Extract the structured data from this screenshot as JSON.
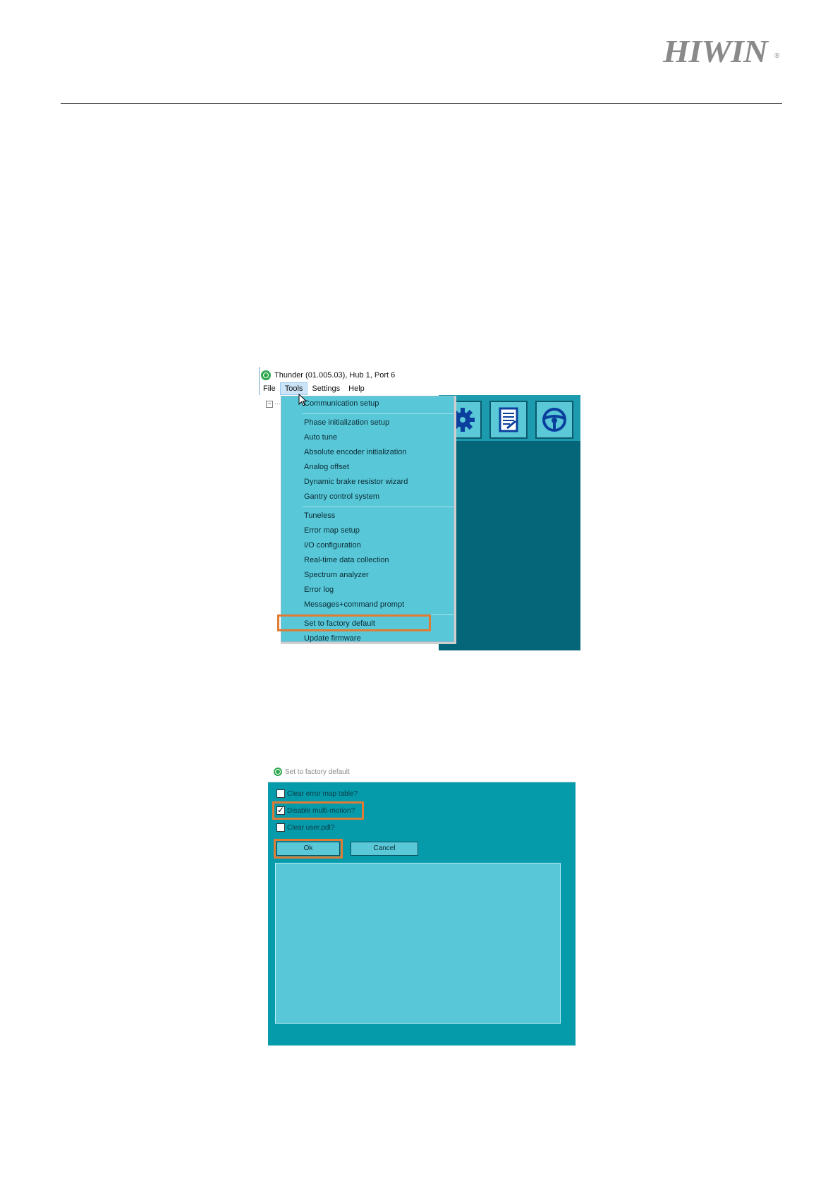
{
  "header": {
    "logo": "HIWIN",
    "logo_mark": "®"
  },
  "tools_menu_screenshot": {
    "title": "Thunder (01.005.03), Hub 1, Port 6",
    "menubar": [
      "File",
      "Tools",
      "Settings",
      "Help"
    ],
    "tree_toggle": "−",
    "tree_dots": "···",
    "active_menu": "Tools",
    "toolbar_icons": [
      "gear-icon",
      "notepad-icon",
      "steering-wheel-icon"
    ],
    "menu_items": [
      "Communication setup",
      "Phase initialization setup",
      "Auto tune",
      "Absolute encoder initialization",
      "Analog offset",
      "Dynamic brake resistor wizard",
      "Gantry control system",
      "Tuneless",
      "Error map setup",
      "I/O configuration",
      "Real-time data collection",
      "Spectrum analyzer",
      "Error log",
      "Messages+command prompt",
      "Set to factory default",
      "Update firmware"
    ],
    "highlighted_item": "Set to factory default",
    "highlight_color": "#e07b33",
    "menu_color": "#58c8d8"
  },
  "factory_default_dialog": {
    "title": "Set to factory default",
    "checkboxes": [
      {
        "label": "Clear error map table?",
        "checked": false
      },
      {
        "label": "Disable multi-motion?",
        "checked": true
      },
      {
        "label": "Clear user.pdl?",
        "checked": false
      }
    ],
    "ok_label": "Ok",
    "cancel_label": "Cancel",
    "background_color": "#069bab"
  }
}
